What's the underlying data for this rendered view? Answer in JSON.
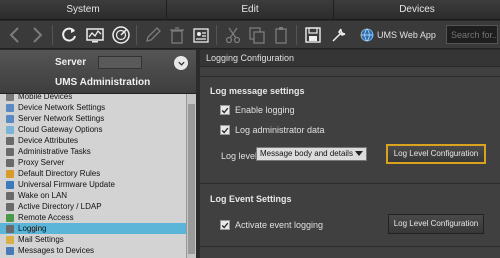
{
  "menu": [
    "System",
    "Edit",
    "Devices"
  ],
  "toolbar": {
    "back_icon": "chevron-left-icon",
    "forward_icon": "chevron-right-icon",
    "ums_web_app_label": "UMS Web App",
    "search_placeholder": "Search for..."
  },
  "left": {
    "server_label": "Server",
    "title": "UMS Administration",
    "tree": [
      {
        "label": "Mobile Devices",
        "icon_color": "#7a7a7a"
      },
      {
        "label": "Device Network Settings",
        "icon_color": "#5a8ac2"
      },
      {
        "label": "Server Network Settings",
        "icon_color": "#5a8ac2"
      },
      {
        "label": "Cloud Gateway Options",
        "icon_color": "#7cb4d9"
      },
      {
        "label": "Device Attributes",
        "icon_color": "#6a6a6a"
      },
      {
        "label": "Administrative Tasks",
        "icon_color": "#6a6a6a"
      },
      {
        "label": "Proxy Server",
        "icon_color": "#6a6a6a"
      },
      {
        "label": "Default Directory Rules",
        "icon_color": "#d89a2a"
      },
      {
        "label": "Universal Firmware Update",
        "icon_color": "#3a7ab8"
      },
      {
        "label": "Wake on LAN",
        "icon_color": "#6a6a6a"
      },
      {
        "label": "Active Directory / LDAP",
        "icon_color": "#6a6a6a"
      },
      {
        "label": "Remote Access",
        "icon_color": "#4a9a4a"
      },
      {
        "label": "Logging",
        "icon_color": "#6a6a6a",
        "selected": true
      },
      {
        "label": "Mail Settings",
        "icon_color": "#d8b04a"
      },
      {
        "label": "Messages to Devices",
        "icon_color": "#4a7ab8"
      }
    ]
  },
  "right": {
    "title": "Logging Configuration",
    "log_message_settings": {
      "title": "Log message settings",
      "enable_logging": "Enable logging",
      "log_admin_data": "Log administrator data",
      "log_level_label": "Log level",
      "log_level_value": "Message body and details",
      "button": "Log Level Configuration"
    },
    "log_event_settings": {
      "title": "Log Event Settings",
      "activate_event_logging": "Activate event logging",
      "button": "Log Level Configuration"
    }
  }
}
